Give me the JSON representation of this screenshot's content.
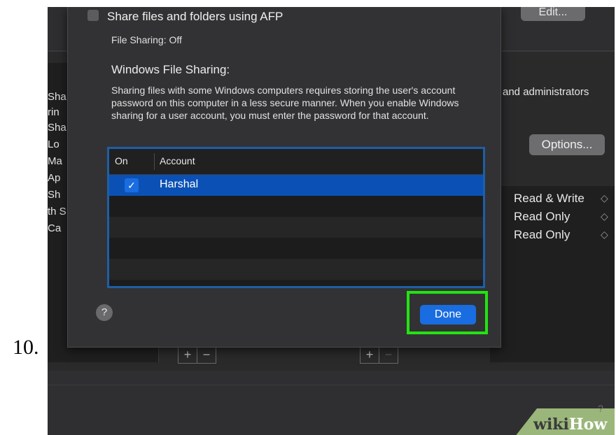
{
  "step_number": "10.",
  "background": {
    "edit_button": "Edit...",
    "left_list_items": [
      "Sha",
      "rin",
      "Sha",
      "Lo",
      "Ma",
      "Ap",
      "Sh",
      "th S",
      "Ca"
    ],
    "users_text": "and administrators",
    "options_button": "Options...",
    "permissions": [
      "Read & Write",
      "Read Only",
      "Read Only"
    ],
    "plus": "+",
    "minus": "−"
  },
  "dialog": {
    "afp_label": "Share files and folders using AFP",
    "afp_checked": false,
    "file_sharing_status": "File Sharing: Off",
    "windows_title": "Windows File Sharing:",
    "windows_description": "Sharing files with some Windows computers requires storing the user's account password on this computer in a less secure manner. When you enable Windows sharing for a user account, you must enter the password for that account.",
    "table": {
      "columns": [
        "On",
        "Account"
      ],
      "rows": [
        {
          "on": true,
          "account": "Harshal"
        }
      ]
    },
    "help_button": "?",
    "done_button": "Done"
  },
  "watermark": {
    "wiki": "wiki",
    "how": "How"
  },
  "colors": {
    "accent_blue": "#1a6de0",
    "selection_blue": "#0b51b5",
    "highlight_green": "#22e312"
  }
}
